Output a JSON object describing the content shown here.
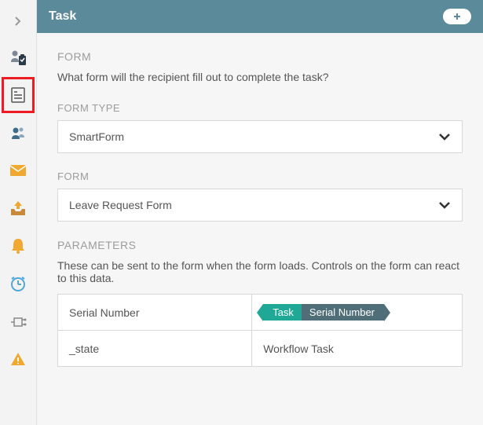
{
  "header": {
    "title": "Task"
  },
  "form": {
    "section_label": "FORM",
    "description": "What form will the recipient fill out to complete the task?",
    "type_label": "FORM TYPE",
    "type_value": "SmartForm",
    "form_label": "FORM",
    "form_value": "Leave Request Form"
  },
  "parameters": {
    "label": "PARAMETERS",
    "description": "These can be sent to the form when the form loads. Controls on the form can react to this data.",
    "rows": [
      {
        "name": "Serial Number",
        "badge_left": "Task",
        "badge_right": "Serial Number"
      },
      {
        "name": "_state",
        "value": "Workflow Task"
      }
    ]
  }
}
